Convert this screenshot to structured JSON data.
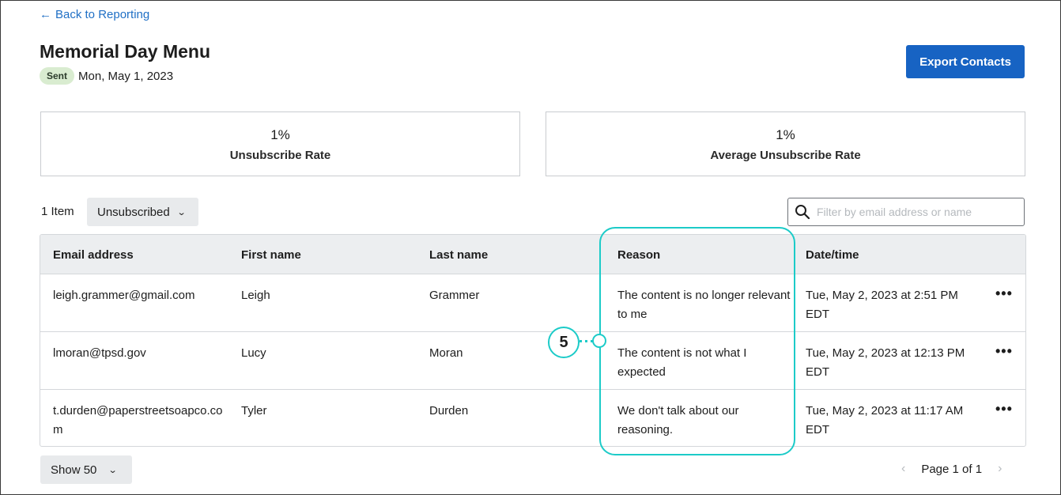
{
  "nav": {
    "back_label": "Back to Reporting"
  },
  "header": {
    "title": "Memorial Day Menu",
    "status_badge": "Sent",
    "sent_date": "Mon, May 1, 2023",
    "export_label": "Export Contacts"
  },
  "stats": [
    {
      "value": "1%",
      "label": "Unsubscribe Rate"
    },
    {
      "value": "1%",
      "label": "Average Unsubscribe Rate"
    }
  ],
  "toolbar": {
    "item_count": "1 Item",
    "filter_value": "Unsubscribed",
    "search_placeholder": "Filter by email address or name"
  },
  "table": {
    "columns": [
      "Email address",
      "First name",
      "Last name",
      "Reason",
      "Date/time"
    ],
    "rows": [
      {
        "email": "leigh.grammer@gmail.com",
        "first": "Leigh",
        "last": "Grammer",
        "reason": "The content is no longer relevant to me",
        "date": "Tue, May 2, 2023 at 2:51 PM EDT"
      },
      {
        "email": "lmoran@tpsd.gov",
        "first": "Lucy",
        "last": "Moran",
        "reason": "The content is not what I expected",
        "date": "Tue, May 2, 2023 at 12:13 PM EDT"
      },
      {
        "email": "t.durden@paperstreetsoapco.com",
        "first": "Tyler",
        "last": "Durden",
        "reason": "We don't talk about our reasoning.",
        "date": "Tue, May 2, 2023 at 11:17 AM EDT"
      }
    ],
    "more_glyph": "•••"
  },
  "footer": {
    "page_size": "Show 50",
    "page_label": "Page 1 of 1"
  },
  "callout": {
    "number": "5"
  },
  "colors": {
    "accent": "#1763c3",
    "link": "#1f6fc5",
    "badge_bg": "#d9ecd0",
    "highlight": "#1ccbc8"
  },
  "icons": {
    "back": "arrow-left-icon",
    "dropdown": "chevron-down-icon",
    "search": "search-icon",
    "more": "more-horizontal-icon",
    "prev": "chevron-left-icon",
    "next": "chevron-right-icon"
  }
}
